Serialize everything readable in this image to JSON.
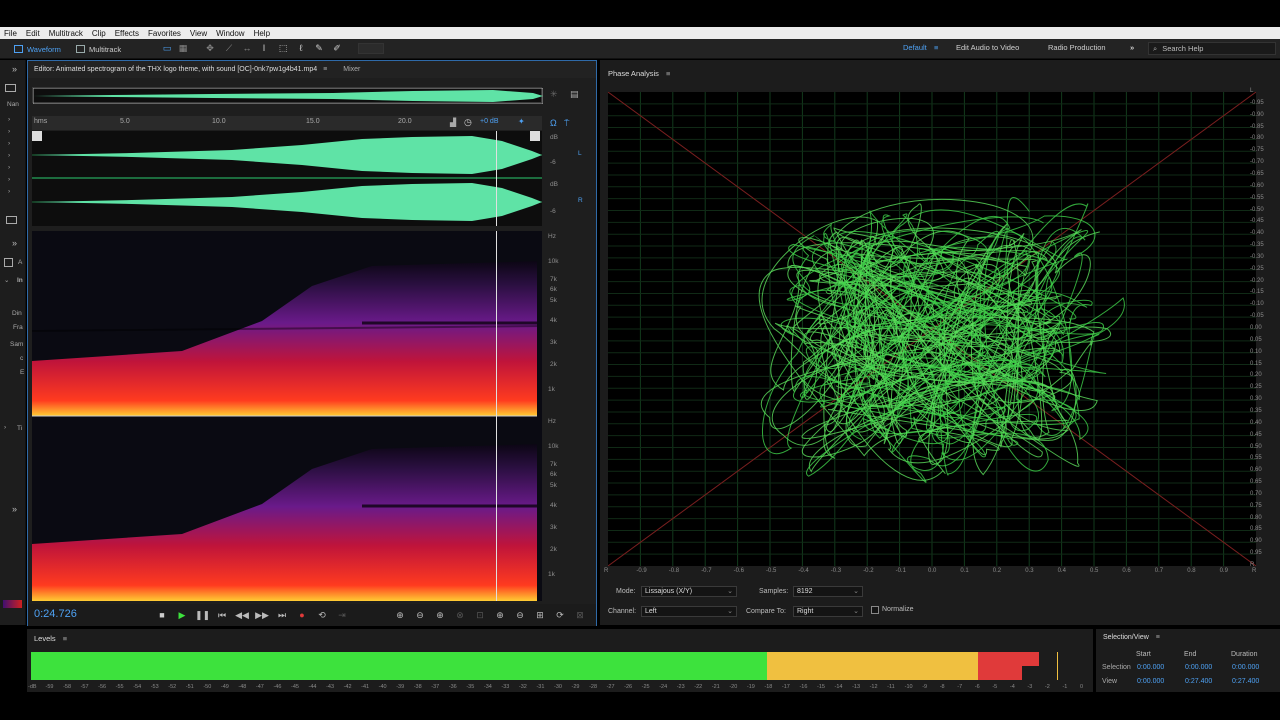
{
  "menu": [
    "File",
    "Edit",
    "Multitrack",
    "Clip",
    "Effects",
    "Favorites",
    "View",
    "Window",
    "Help"
  ],
  "toolbar": {
    "waveform_label": "Waveform",
    "multitrack_label": "Multitrack",
    "workspaces": [
      "Default",
      "Edit Audio to Video",
      "Radio Production"
    ],
    "search_placeholder": "Search Help"
  },
  "sidebar": {
    "labels": [
      "Nan",
      "A",
      "In",
      "Din",
      "Fra",
      "Sam",
      "c",
      "E",
      "Ti"
    ]
  },
  "editor": {
    "tab_title": "Editor: Animated spectrogram of the THX logo theme, with sound [OC]-0nk7pw1g4b41.mp4",
    "mixer_label": "Mixer",
    "ruler_labels": [
      "hms",
      "5.0",
      "10.0",
      "15.0",
      "20.0"
    ],
    "volume": "+0 dB",
    "db_labels": [
      "dB",
      "-6",
      "dB",
      "-6"
    ],
    "channel_left": "L",
    "channel_right": "R",
    "hz_labels_top": [
      "Hz",
      "10k",
      "7k",
      "6k",
      "5k",
      "4k",
      "3k",
      "2k",
      "1k"
    ],
    "hz_labels_bottom": [
      "Hz",
      "10k",
      "7k",
      "6k",
      "5k",
      "4k",
      "3k",
      "2k",
      "1k"
    ],
    "time_readout": "0:24.726",
    "playhead_fraction": 0.91
  },
  "phase": {
    "title": "Phase Analysis",
    "right_scale": [
      "L",
      "-0.95",
      "-0.90",
      "-0.85",
      "-0.80",
      "-0.75",
      "-0.70",
      "-0.65",
      "-0.60",
      "-0.55",
      "-0.50",
      "-0.45",
      "-0.40",
      "-0.35",
      "-0.30",
      "-0.25",
      "-0.20",
      "-0.15",
      "-0.10",
      "-0.05",
      "0.00",
      "0.05",
      "0.10",
      "0.15",
      "0.20",
      "0.25",
      "0.30",
      "0.35",
      "0.40",
      "0.45",
      "0.50",
      "0.55",
      "0.60",
      "0.65",
      "0.70",
      "0.75",
      "0.80",
      "0.85",
      "0.90",
      "0.95",
      "R"
    ],
    "bottom_scale": [
      "R",
      "-0.9",
      "-0.8",
      "-0.7",
      "-0.6",
      "-0.5",
      "-0.4",
      "-0.3",
      "-0.2",
      "-0.1",
      "0.0",
      "0.1",
      "0.2",
      "0.3",
      "0.4",
      "0.5",
      "0.6",
      "0.7",
      "0.8",
      "0.9",
      "R"
    ],
    "mode_label": "Mode:",
    "mode_value": "Lissajous (X/Y)",
    "samples_label": "Samples:",
    "samples_value": "8192",
    "channel_label": "Channel:",
    "channel_value": "Left",
    "compare_label": "Compare To:",
    "compare_value": "Right",
    "normalize_label": "Normalize"
  },
  "levels": {
    "title": "Levels",
    "ticks": [
      "-dB",
      "-59",
      "-58",
      "-57",
      "-56",
      "-55",
      "-54",
      "-53",
      "-52",
      "-51",
      "-50",
      "-49",
      "-48",
      "-47",
      "-46",
      "-45",
      "-44",
      "-43",
      "-42",
      "-41",
      "-40",
      "-39",
      "-38",
      "-37",
      "-36",
      "-35",
      "-34",
      "-33",
      "-32",
      "-31",
      "-30",
      "-29",
      "-28",
      "-27",
      "-26",
      "-25",
      "-24",
      "-23",
      "-22",
      "-21",
      "-20",
      "-19",
      "-18",
      "-17",
      "-16",
      "-15",
      "-14",
      "-13",
      "-12",
      "-11",
      "-10",
      "-9",
      "-8",
      "-7",
      "-6",
      "-5",
      "-4",
      "-3",
      "-2",
      "-1",
      "0"
    ],
    "level_top_db": -2.5,
    "level_bottom_db": -3.5,
    "peak_db": -1.5,
    "colors": {
      "green": "#3de23d",
      "yellow": "#f0c040",
      "red": "#e03a3a"
    }
  },
  "selection_view": {
    "title": "Selection/View",
    "headers": [
      "Start",
      "End",
      "Duration"
    ],
    "rows": [
      {
        "label": "Selection",
        "start": "0:00.000",
        "end": "0:00.000",
        "duration": "0:00.000"
      },
      {
        "label": "View",
        "start": "0:00.000",
        "end": "0:27.400",
        "duration": "0:27.400"
      }
    ]
  }
}
